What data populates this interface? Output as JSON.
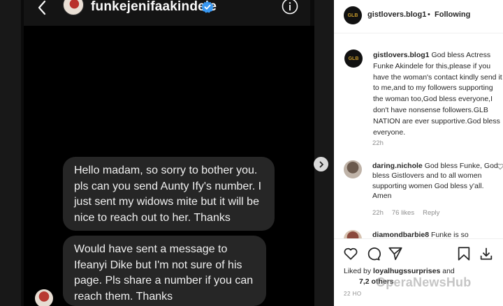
{
  "dm": {
    "username": "funkejenifaakindele",
    "messages": [
      "Hello madam, so sorry to bother you. pls can you send Aunty Ify's number. I just sent my widows mite but it will be nice to reach out to her. Thanks",
      "Would have sent a message to Ifeanyi Dike but I'm not sure of his page. Pls share a number if you can reach them. Thanks"
    ]
  },
  "post": {
    "account": "gistlovers.blog1",
    "separator": "•",
    "follow_status": "Following",
    "logo_text": "GLB",
    "caption": {
      "user": "gistlovers.blog1",
      "text": "God bless Actress Funke Akindele for this,please if you have the woman's contact kindly send it to me,and to my followers supporting the woman too,God bless everyone,I don't have nonsense followers.GLB NATION are ever supportive.God bless everyone.",
      "time": "22h"
    },
    "comments": [
      {
        "user": "daring.nichole",
        "text": "God bless Funke, God bless Gistlovers and to all women supporting women God bless y'all. Amen",
        "time": "22h",
        "likes": "76 likes",
        "reply": "Reply"
      },
      {
        "user": "diamondbarbie8",
        "text": "Funke is so"
      }
    ],
    "liked_by_prefix": "Liked by",
    "liked_by_user": "loyalhugssurprises",
    "liked_by_suffix": "and",
    "likes_count": "7,2",
    "likes_others": "others",
    "post_time": "22 HO"
  },
  "watermark": "OperaNewsHub",
  "icons": [
    "back-icon",
    "verified-icon",
    "info-icon",
    "chevron-right-icon",
    "heart-icon",
    "comment-icon",
    "share-icon",
    "bookmark-icon",
    "download-icon"
  ]
}
